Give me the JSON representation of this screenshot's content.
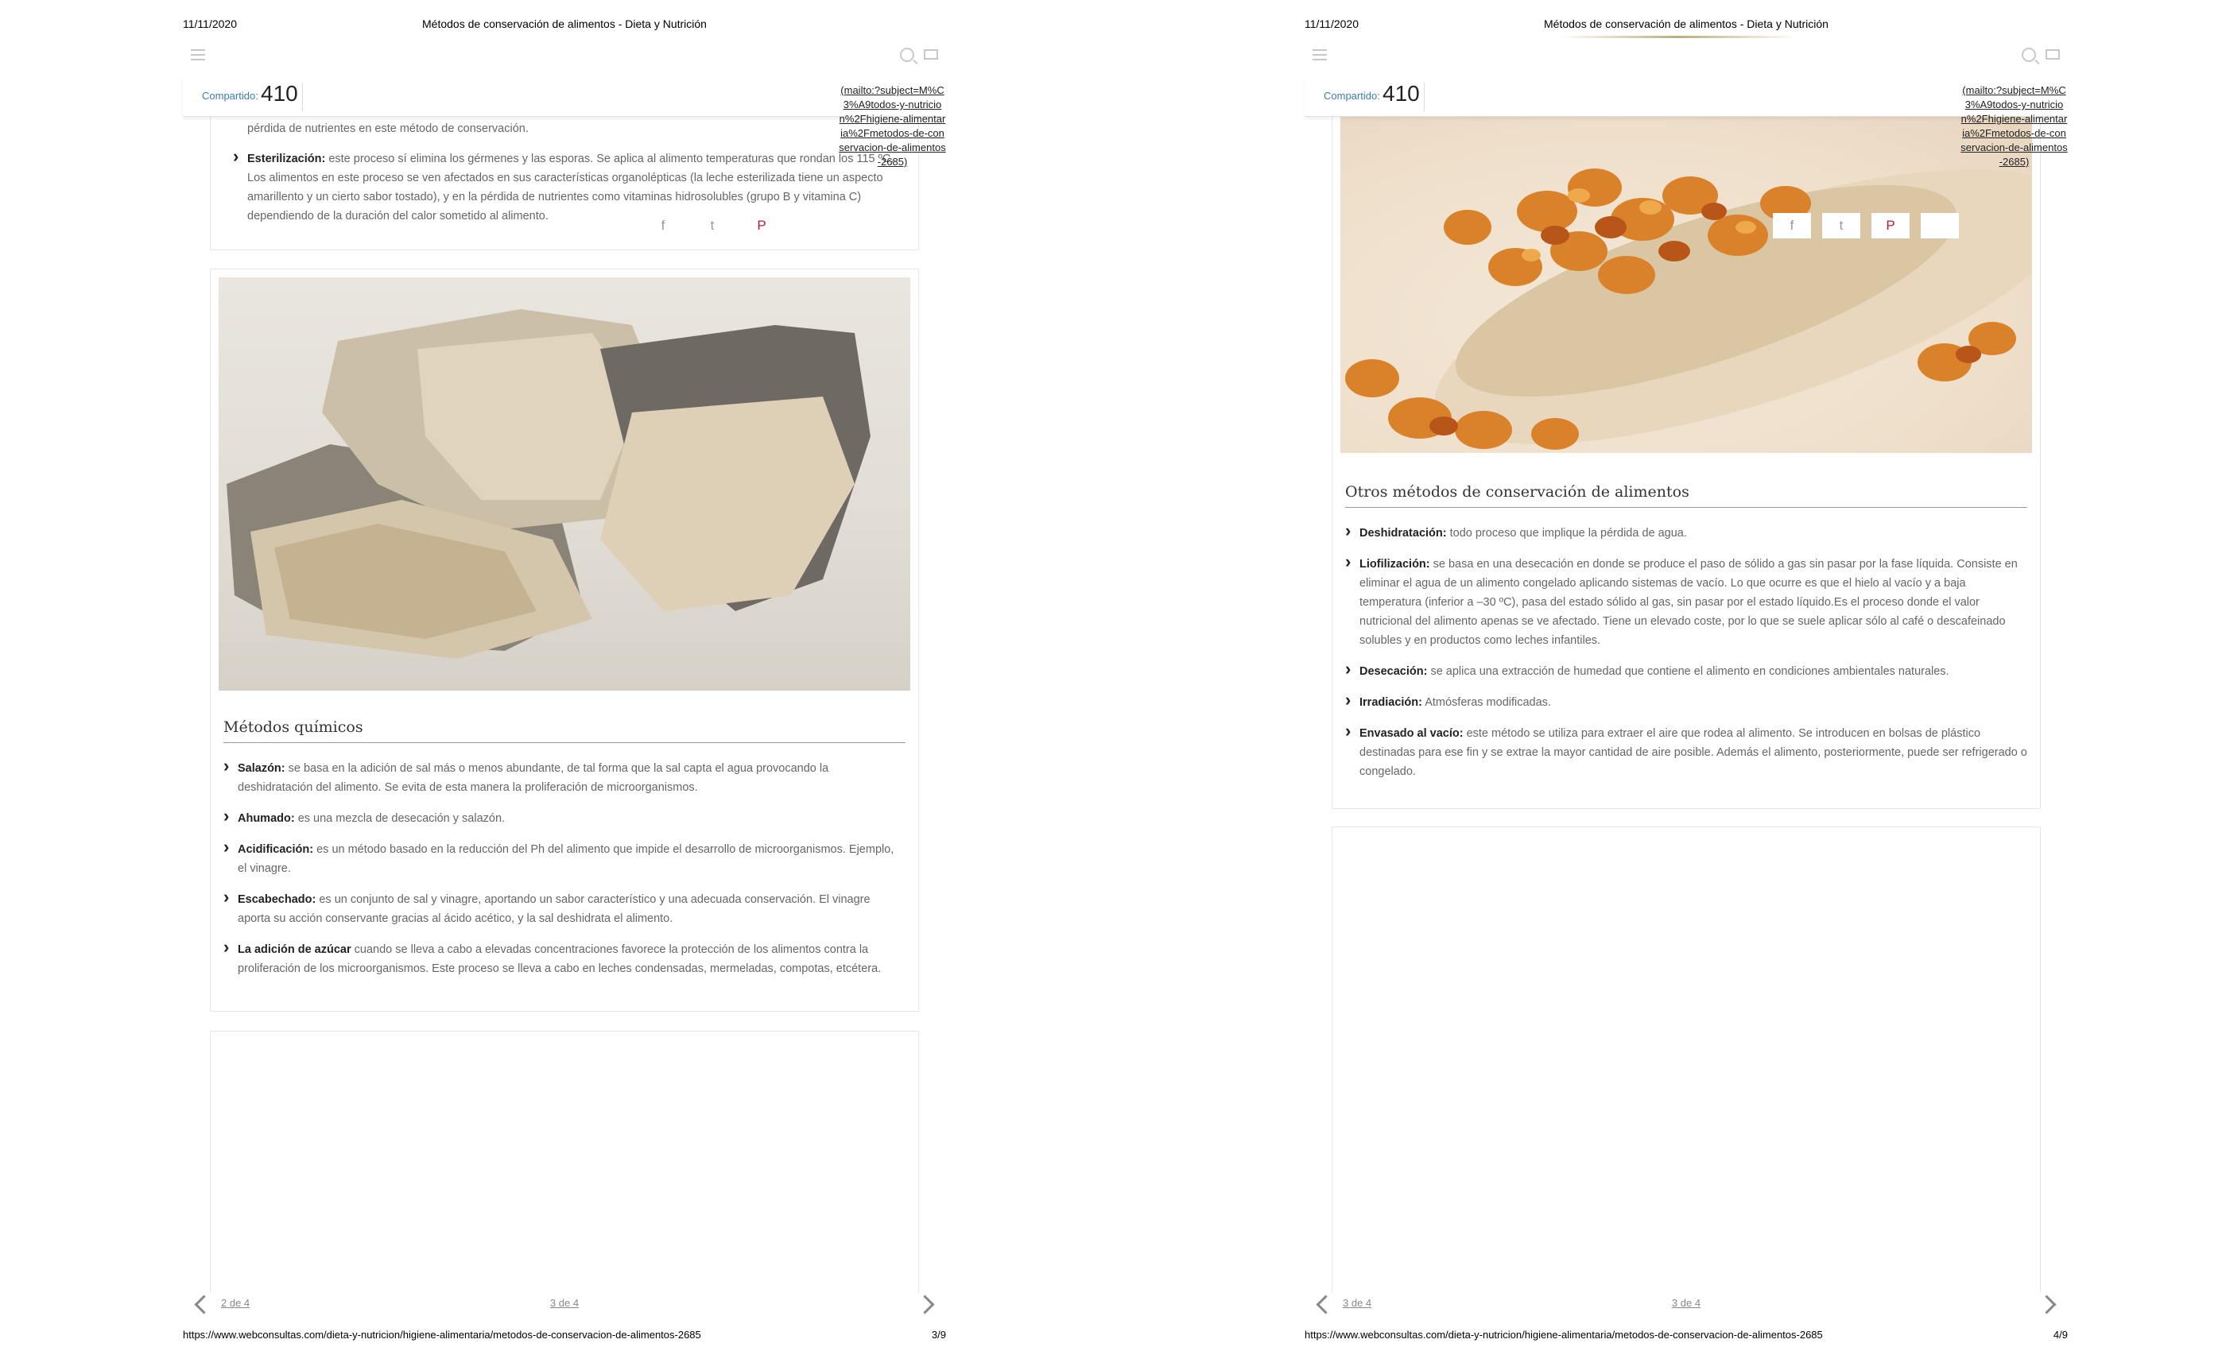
{
  "print_date": "11/11/2020",
  "doc_title": "Métodos de conservación de alimentos - Dieta y Nutrición",
  "share": {
    "label": "Compartido:",
    "count": "410"
  },
  "mailto_text": "(mailto:?subject=M%C3%A9todos-y-nutricion%2Fhigiene-alimentaria%2Fmetodos-de-conservacion-de-alimentos-2685)",
  "social": {
    "facebook": "f",
    "twitter": "t",
    "pinterest": "P"
  },
  "footer_url": "https://www.webconsultas.com/dieta-y-nutricion/higiene-alimentaria/metodos-de-conservacion-de-alimentos-2685",
  "page1": {
    "top_frag": "pérdida de nutrientes en este método de conservación.",
    "esterilizacion_label": "Esterilización:",
    "esterilizacion_text": " este proceso sí elimina los gérmenes y las esporas. Se aplica al alimento temperaturas que rondan los 115 ºC. Los alimentos en este proceso se ven afectados en sus características organolépticas (la leche esterilizada tiene un aspecto amarillento y un cierto sabor tostado), y en la pérdida de nutrientes como vitaminas hidrosolubles (grupo B y vitamina C) dependiendo de la duración del calor sometido al alimento.",
    "section_title": "Métodos químicos",
    "items": [
      {
        "label": "Salazón:",
        "text": " se basa en la adición de sal más o menos abundante, de tal forma que la sal capta el agua provocando la deshidratación del alimento. Se evita de esta manera la proliferación de microorganismos."
      },
      {
        "label": "Ahumado:",
        "text": " es una mezcla de desecación y salazón."
      },
      {
        "label": "Acidificación:",
        "text": " es un método basado en la reducción del Ph del alimento que impide el desarrollo de microorganismos. Ejemplo, el vinagre."
      },
      {
        "label": "Escabechado:",
        "text": " es un conjunto de sal y vinagre, aportando un sabor característico y una adecuada conservación. El vinagre aporta su acción conservante gracias al ácido acético, y la sal deshidrata el alimento."
      },
      {
        "label": "La adición de azúcar",
        "text": " cuando se lleva a cabo a elevadas concentraciones favorece la protección de los alimentos contra la proliferación de los microorganismos. Este proceso se lleva a cabo en leches condensadas, mermeladas, compotas, etcétera."
      }
    ],
    "prev_link": "2 de 4",
    "cur_link": "3 de 4",
    "page_num": "3/9"
  },
  "page2": {
    "section_title": "Otros métodos de conservación de alimentos",
    "items": [
      {
        "label": "Deshidratación:",
        "text": " todo proceso que implique la pérdida de agua."
      },
      {
        "label": "Liofilización:",
        "text": " se basa en una desecación en donde se produce el paso de sólido a gas sin pasar por la fase líquida. Consiste en eliminar el agua de un alimento congelado aplicando sistemas de vacío. Lo que ocurre es que el hielo al vacío y a baja temperatura (inferior a –30 ºC), pasa del estado sólido al gas, sin pasar por el estado líquido.Es el proceso donde el valor nutricional del alimento apenas se ve afectado. Tiene un elevado coste, por lo que se suele aplicar sólo al café o descafeinado solubles y en productos como leches infantiles."
      },
      {
        "label": "Desecación:",
        "text": " se aplica una extracción de humedad que contiene el alimento en condiciones ambientales naturales."
      },
      {
        "label": "Irradiación:",
        "text": " Atmósferas modificadas."
      },
      {
        "label": "Envasado al vacío:",
        "text": " este método se utiliza para extraer el aire que rodea al alimento. Se introducen en bolsas de plástico destinadas para ese fin y se extrae la mayor cantidad de aire posible. Además el alimento, posteriormente, puede ser refrigerado o congelado."
      }
    ],
    "prev_link": "3 de 4",
    "cur_link": "3 de 4",
    "page_num": "4/9"
  }
}
